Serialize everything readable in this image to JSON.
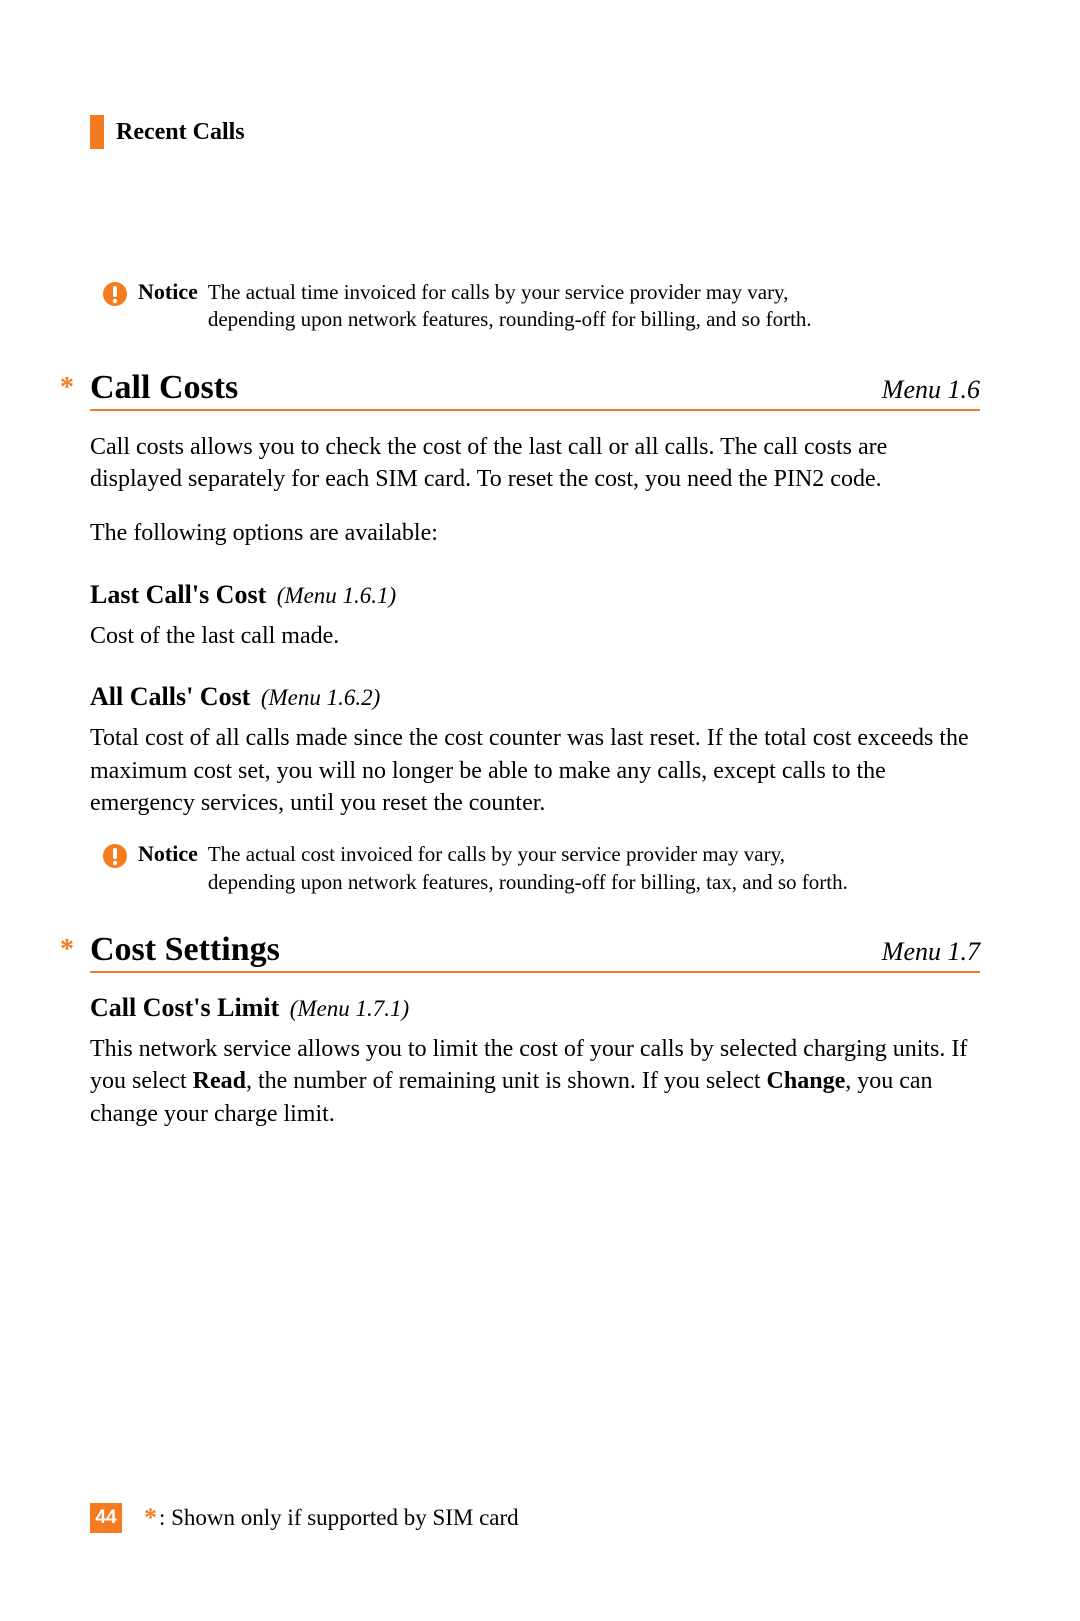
{
  "header": {
    "title": "Recent Calls"
  },
  "notices": [
    {
      "label": "Notice",
      "text": "The actual time invoiced for calls by your service provider may vary, depending upon network features, rounding-off for billing, and so forth."
    },
    {
      "label": "Notice",
      "text": "The actual cost invoiced for calls by your service provider may vary, depending upon network features, rounding-off for billing, tax, and so forth."
    }
  ],
  "sections": [
    {
      "marker": "*",
      "title": "Call Costs",
      "menu": "Menu 1.6",
      "body": [
        "Call costs allows you to check the cost of the last call or all calls. The call costs are displayed separately for each SIM card. To reset the cost, you need the PIN2 code.",
        "The following options are available:"
      ],
      "subs": [
        {
          "title": "Last Call's Cost",
          "menu": "(Menu 1.6.1)",
          "body": "Cost of the last call made."
        },
        {
          "title": "All Calls' Cost",
          "menu": "(Menu 1.6.2)",
          "body": "Total cost of all calls made since the cost counter was last reset. If the total cost exceeds the maximum cost set, you will no longer be able to make any calls, except calls to the emergency services, until you reset the counter."
        }
      ]
    },
    {
      "marker": "*",
      "title": "Cost Settings",
      "menu": "Menu 1.7",
      "subs": [
        {
          "title": "Call Cost's Limit",
          "menu": "(Menu 1.7.1)",
          "body_parts": [
            "This network service allows you to limit the cost of your calls by selected charging units. If you select ",
            "Read",
            ", the number of remaining unit is shown. If you select ",
            "Change",
            ", you can change your charge limit."
          ]
        }
      ]
    }
  ],
  "footer": {
    "page_number": "44",
    "star": "*",
    "note": ": Shown only if supported by SIM card"
  }
}
